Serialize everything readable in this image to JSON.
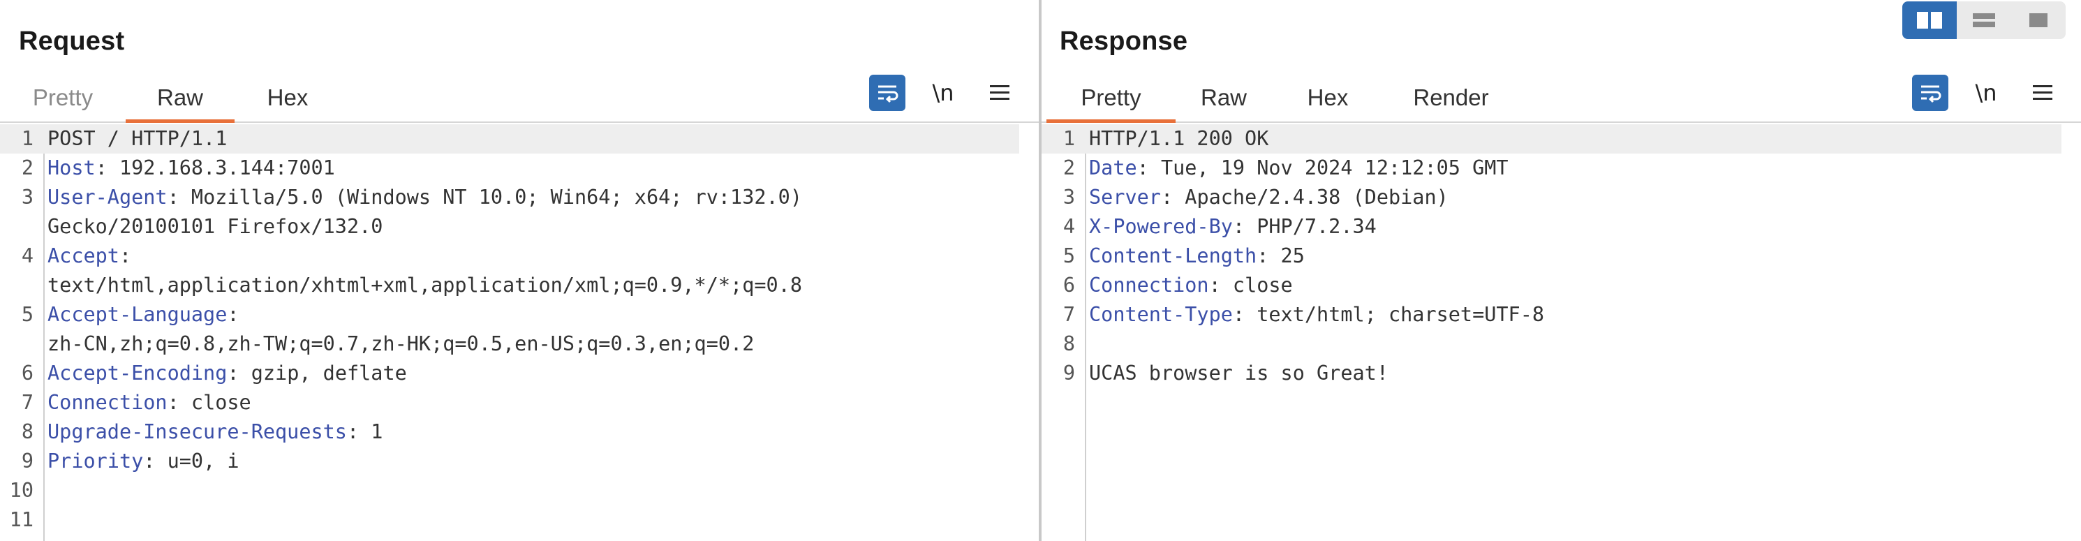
{
  "request": {
    "title": "Request",
    "tabs": [
      {
        "label": "Pretty",
        "state": "inactive"
      },
      {
        "label": "Raw",
        "state": "active"
      },
      {
        "label": "Hex",
        "state": "inactive"
      }
    ],
    "toolbar": {
      "newline_label": "\\n"
    },
    "lines": [
      {
        "num": "1",
        "text": "POST / HTTP/1.1"
      },
      {
        "num": "2",
        "name": "Host",
        "value": "192.168.3.144:7001"
      },
      {
        "num": "3",
        "name": "User-Agent",
        "value": "Mozilla/5.0 (Windows NT 10.0; Win64; x64; rv:132.0)"
      },
      {
        "num": "",
        "text": "Gecko/20100101 Firefox/132.0"
      },
      {
        "num": "4",
        "name": "Accept",
        "value": ""
      },
      {
        "num": "",
        "text": "text/html,application/xhtml+xml,application/xml;q=0.9,*/*;q=0.8"
      },
      {
        "num": "5",
        "name": "Accept-Language",
        "value": ""
      },
      {
        "num": "",
        "text": "zh-CN,zh;q=0.8,zh-TW;q=0.7,zh-HK;q=0.5,en-US;q=0.3,en;q=0.2"
      },
      {
        "num": "6",
        "name": "Accept-Encoding",
        "value": "gzip, deflate"
      },
      {
        "num": "7",
        "name": "Connection",
        "value": "close"
      },
      {
        "num": "8",
        "name": "Upgrade-Insecure-Requests",
        "value": "1"
      },
      {
        "num": "9",
        "name": "Priority",
        "value": "u=0, i"
      },
      {
        "num": "10",
        "text": ""
      },
      {
        "num": "11",
        "text": ""
      }
    ]
  },
  "response": {
    "title": "Response",
    "tabs": [
      {
        "label": "Pretty",
        "state": "active"
      },
      {
        "label": "Raw",
        "state": "inactive"
      },
      {
        "label": "Hex",
        "state": "inactive"
      },
      {
        "label": "Render",
        "state": "inactive"
      }
    ],
    "toolbar": {
      "newline_label": "\\n"
    },
    "lines": [
      {
        "num": "1",
        "text": "HTTP/1.1 200 OK"
      },
      {
        "num": "2",
        "name": "Date",
        "value": "Tue, 19 Nov 2024 12:12:05 GMT"
      },
      {
        "num": "3",
        "name": "Server",
        "value": "Apache/2.4.38 (Debian)"
      },
      {
        "num": "4",
        "name": "X-Powered-By",
        "value": "PHP/7.2.34"
      },
      {
        "num": "5",
        "name": "Content-Length",
        "value": "25"
      },
      {
        "num": "6",
        "name": "Connection",
        "value": "close"
      },
      {
        "num": "7",
        "name": "Content-Type",
        "value": "text/html; charset=UTF-8"
      },
      {
        "num": "8",
        "text": ""
      },
      {
        "num": "9",
        "text": "UCAS browser is so Great!"
      }
    ]
  },
  "view_layout": {
    "options": [
      "side-by-side",
      "top-bottom",
      "single"
    ],
    "selected": "side-by-side"
  },
  "colors": {
    "accent_tab": "#e8703a",
    "button_blue": "#2f6db3",
    "header_name": "#3b4fa8"
  }
}
